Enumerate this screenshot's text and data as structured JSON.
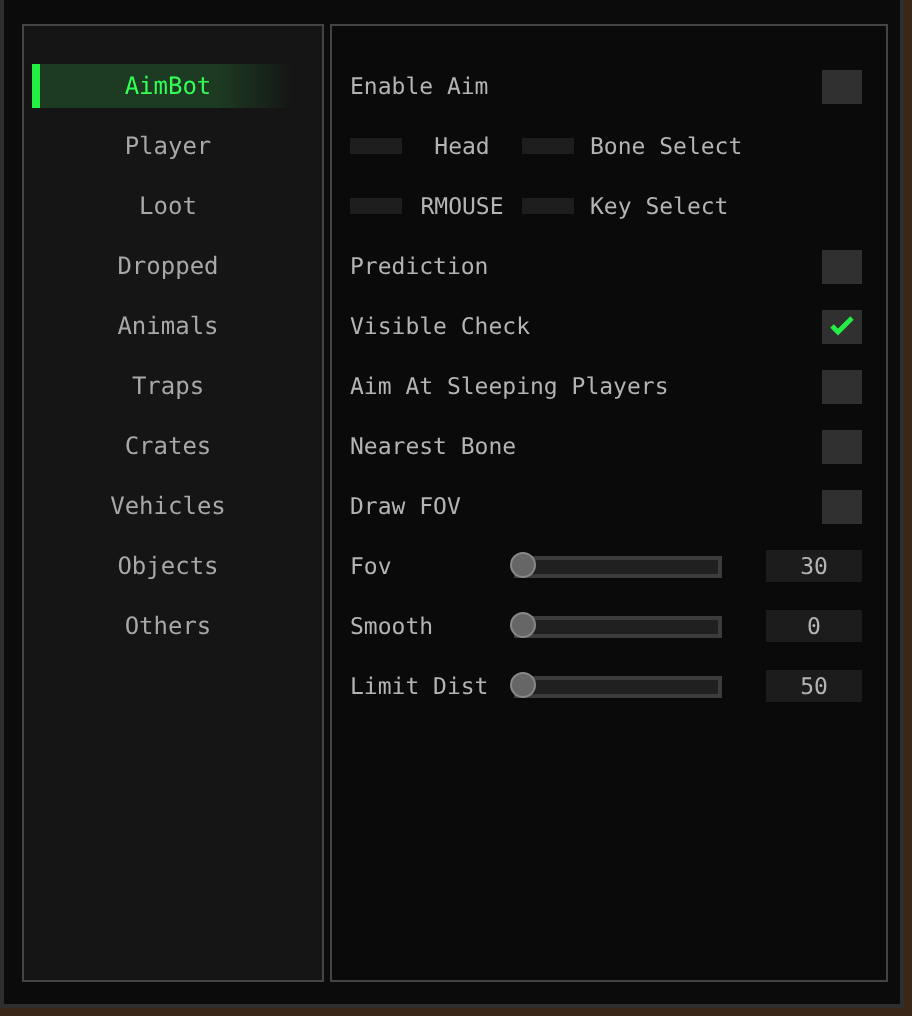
{
  "sidebar": {
    "items": [
      {
        "label": "AimBot",
        "selected": true
      },
      {
        "label": "Player",
        "selected": false
      },
      {
        "label": "Loot",
        "selected": false
      },
      {
        "label": "Dropped",
        "selected": false
      },
      {
        "label": "Animals",
        "selected": false
      },
      {
        "label": "Traps",
        "selected": false
      },
      {
        "label": "Crates",
        "selected": false
      },
      {
        "label": "Vehicles",
        "selected": false
      },
      {
        "label": "Objects",
        "selected": false
      },
      {
        "label": "Others",
        "selected": false
      }
    ]
  },
  "settings": [
    {
      "kind": "checkbox",
      "label": "Enable Aim",
      "checked": false
    },
    {
      "kind": "select",
      "option": "Head",
      "label": "Bone Select"
    },
    {
      "kind": "select",
      "option": "RMOUSE",
      "label": "Key Select"
    },
    {
      "kind": "checkbox",
      "label": "Prediction",
      "checked": false
    },
    {
      "kind": "checkbox",
      "label": "Visible Check",
      "checked": true
    },
    {
      "kind": "checkbox",
      "label": "Aim At Sleeping Players",
      "checked": false
    },
    {
      "kind": "checkbox",
      "label": "Nearest Bone",
      "checked": false
    },
    {
      "kind": "checkbox",
      "label": "Draw FOV",
      "checked": false
    },
    {
      "kind": "slider",
      "label": "Fov",
      "level": 0,
      "value": "30"
    },
    {
      "kind": "slider",
      "label": "Smooth",
      "level": 0,
      "value": "0"
    },
    {
      "kind": "slider",
      "label": "Limit Dist",
      "level": 0,
      "value": "50"
    }
  ]
}
